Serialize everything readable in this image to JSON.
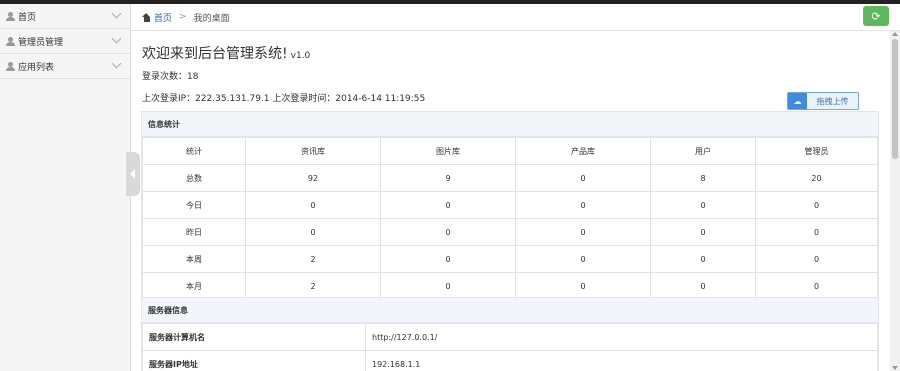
{
  "sidebar": {
    "items": [
      {
        "label": "首页",
        "icon": "user-icon"
      },
      {
        "label": "管理员管理",
        "icon": "user-icon"
      },
      {
        "label": "应用列表",
        "icon": "user-icon"
      }
    ]
  },
  "breadcrumb": {
    "home": "首页",
    "separator": ">",
    "current": "我的桌面"
  },
  "refresh": {
    "icon": "refresh-icon",
    "glyph": "⟳"
  },
  "welcome": {
    "title": "欢迎来到后台管理系统!",
    "version": "v1.0"
  },
  "login": {
    "count_text": "登录次数：18",
    "last_text": "上次登录IP：222.35.131.79.1 上次登录时间：2014-6-14 11:19:55"
  },
  "upload": {
    "label": "拖拽上传",
    "icon": "cloud-icon",
    "glyph": "☁"
  },
  "stats": {
    "heading": "信息统计",
    "columns": [
      "统计",
      "资讯库",
      "图片库",
      "产品库",
      "用户",
      "管理员"
    ],
    "rows": [
      [
        "总数",
        "92",
        "9",
        "0",
        "8",
        "20"
      ],
      [
        "今日",
        "0",
        "0",
        "0",
        "0",
        "0"
      ],
      [
        "昨日",
        "0",
        "0",
        "0",
        "0",
        "0"
      ],
      [
        "本周",
        "2",
        "0",
        "0",
        "0",
        "0"
      ],
      [
        "本月",
        "2",
        "0",
        "0",
        "0",
        "0"
      ]
    ]
  },
  "server": {
    "heading": "服务器信息",
    "rows": [
      {
        "key": "服务器计算机名",
        "value": "http://127.0.0.1/"
      },
      {
        "key": "服务器IP地址",
        "value": "192.168.1.1"
      }
    ]
  },
  "colors": {
    "accent": "#2a6ab5",
    "refresh_bg": "#5eb95e",
    "panel_head": "#f2f6fb"
  }
}
